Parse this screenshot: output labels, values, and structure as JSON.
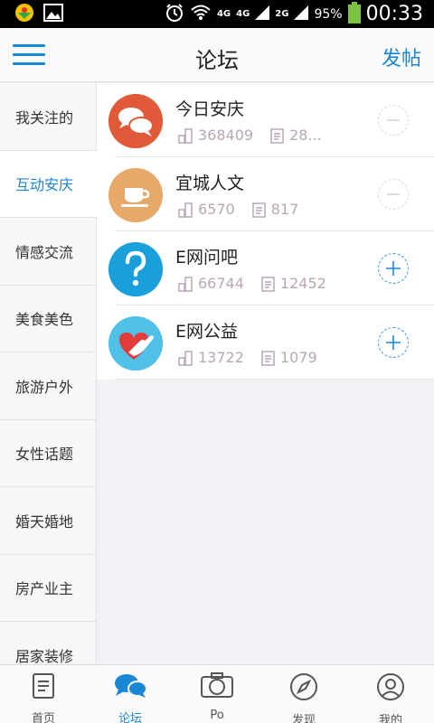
{
  "status_bar": {
    "network_1": "4G",
    "network_2": "4G",
    "network_3": "2G",
    "battery": "95%",
    "time": "00:33"
  },
  "header": {
    "title": "论坛",
    "post_label": "发帖"
  },
  "sidebar": {
    "items": [
      {
        "label": "我关注的"
      },
      {
        "label": "互动安庆"
      },
      {
        "label": "情感交流"
      },
      {
        "label": "美食美色"
      },
      {
        "label": "旅游户外"
      },
      {
        "label": "女性话题"
      },
      {
        "label": "婚天婚地"
      },
      {
        "label": "房产业主"
      },
      {
        "label": "居家装修"
      }
    ],
    "active_index": 1
  },
  "forums": [
    {
      "name": "今日安庆",
      "members": "368409",
      "posts": "28...",
      "action": "minus",
      "icon": "chat-bubbles-icon",
      "color": "#e05a3a"
    },
    {
      "name": "宜城人文",
      "members": "6570",
      "posts": "817",
      "action": "minus",
      "icon": "coffee-cup-icon",
      "color": "#e6a96a"
    },
    {
      "name": "E网问吧",
      "members": "66744",
      "posts": "12452",
      "action": "plus",
      "icon": "question-mark-icon",
      "color": "#1a9fdd"
    },
    {
      "name": "E网公益",
      "members": "13722",
      "posts": "1079",
      "action": "plus",
      "icon": "hand-heart-icon",
      "color": "#4fc0e8"
    }
  ],
  "bottom_nav": [
    {
      "label": "首页",
      "icon": "document-icon"
    },
    {
      "label": "论坛",
      "icon": "chat-bubbles-icon"
    },
    {
      "label": "Po",
      "icon": "camera-icon"
    },
    {
      "label": "发现",
      "icon": "compass-icon"
    },
    {
      "label": "我的",
      "icon": "user-icon"
    }
  ],
  "bottom_nav_active_index": 1,
  "colors": {
    "accent": "#1a86d6",
    "stat_text": "#b9a6b6"
  }
}
